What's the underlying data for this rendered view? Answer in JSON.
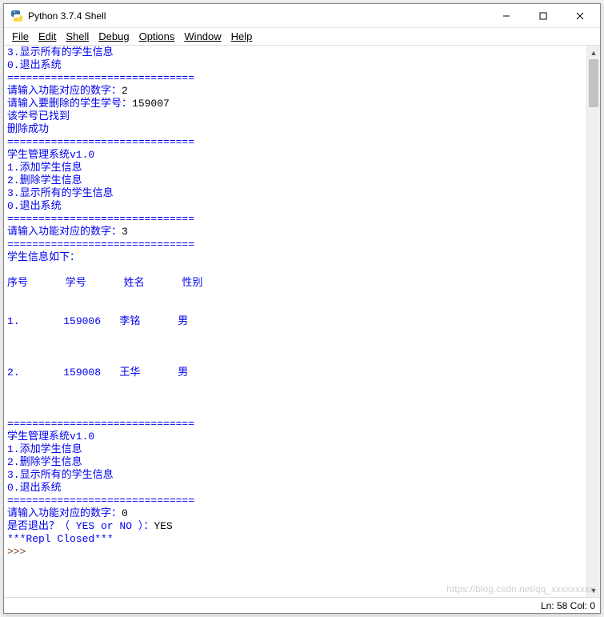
{
  "window": {
    "title": "Python 3.7.4 Shell",
    "min_tooltip": "Minimize",
    "max_tooltip": "Maximize",
    "close_tooltip": "Close"
  },
  "menu": {
    "file": "File",
    "edit": "Edit",
    "shell": "Shell",
    "debug": "Debug",
    "options": "Options",
    "window": "Window",
    "help": "Help"
  },
  "shell": {
    "line01": "3.显示所有的学生信息",
    "line02": "0.退出系统",
    "sep": "==============================",
    "prompt_choice": "请输入功能对应的数字：",
    "choice1": "2",
    "prompt_delete_id": "请输入要删除的学生学号：",
    "delete_id": "159007",
    "found": "该学号已找到",
    "deleted": "删除成功",
    "sys_title": "学生管理系统v1.0",
    "menu1": "1.添加学生信息",
    "menu2": "2.删除学生信息",
    "menu3": "3.显示所有的学生信息",
    "menu0": "0.退出系统",
    "choice2": "3",
    "list_header": "学生信息如下：",
    "cols": "序号      学号      姓名      性别",
    "row1": "1.       159006   李铭      男",
    "row2": "2.       159008   王华      男",
    "choice3": "0",
    "confirm_exit_prompt": "是否退出？（ YES or NO ）：",
    "confirm_exit_answer": "YES",
    "repl_closed": "***Repl Closed***",
    "prompt_symbol": ">>> "
  },
  "status": {
    "text": "Ln: 58  Col: 0"
  },
  "watermark": "https://blog.csdn.net/qq_xxxxxxxxx"
}
